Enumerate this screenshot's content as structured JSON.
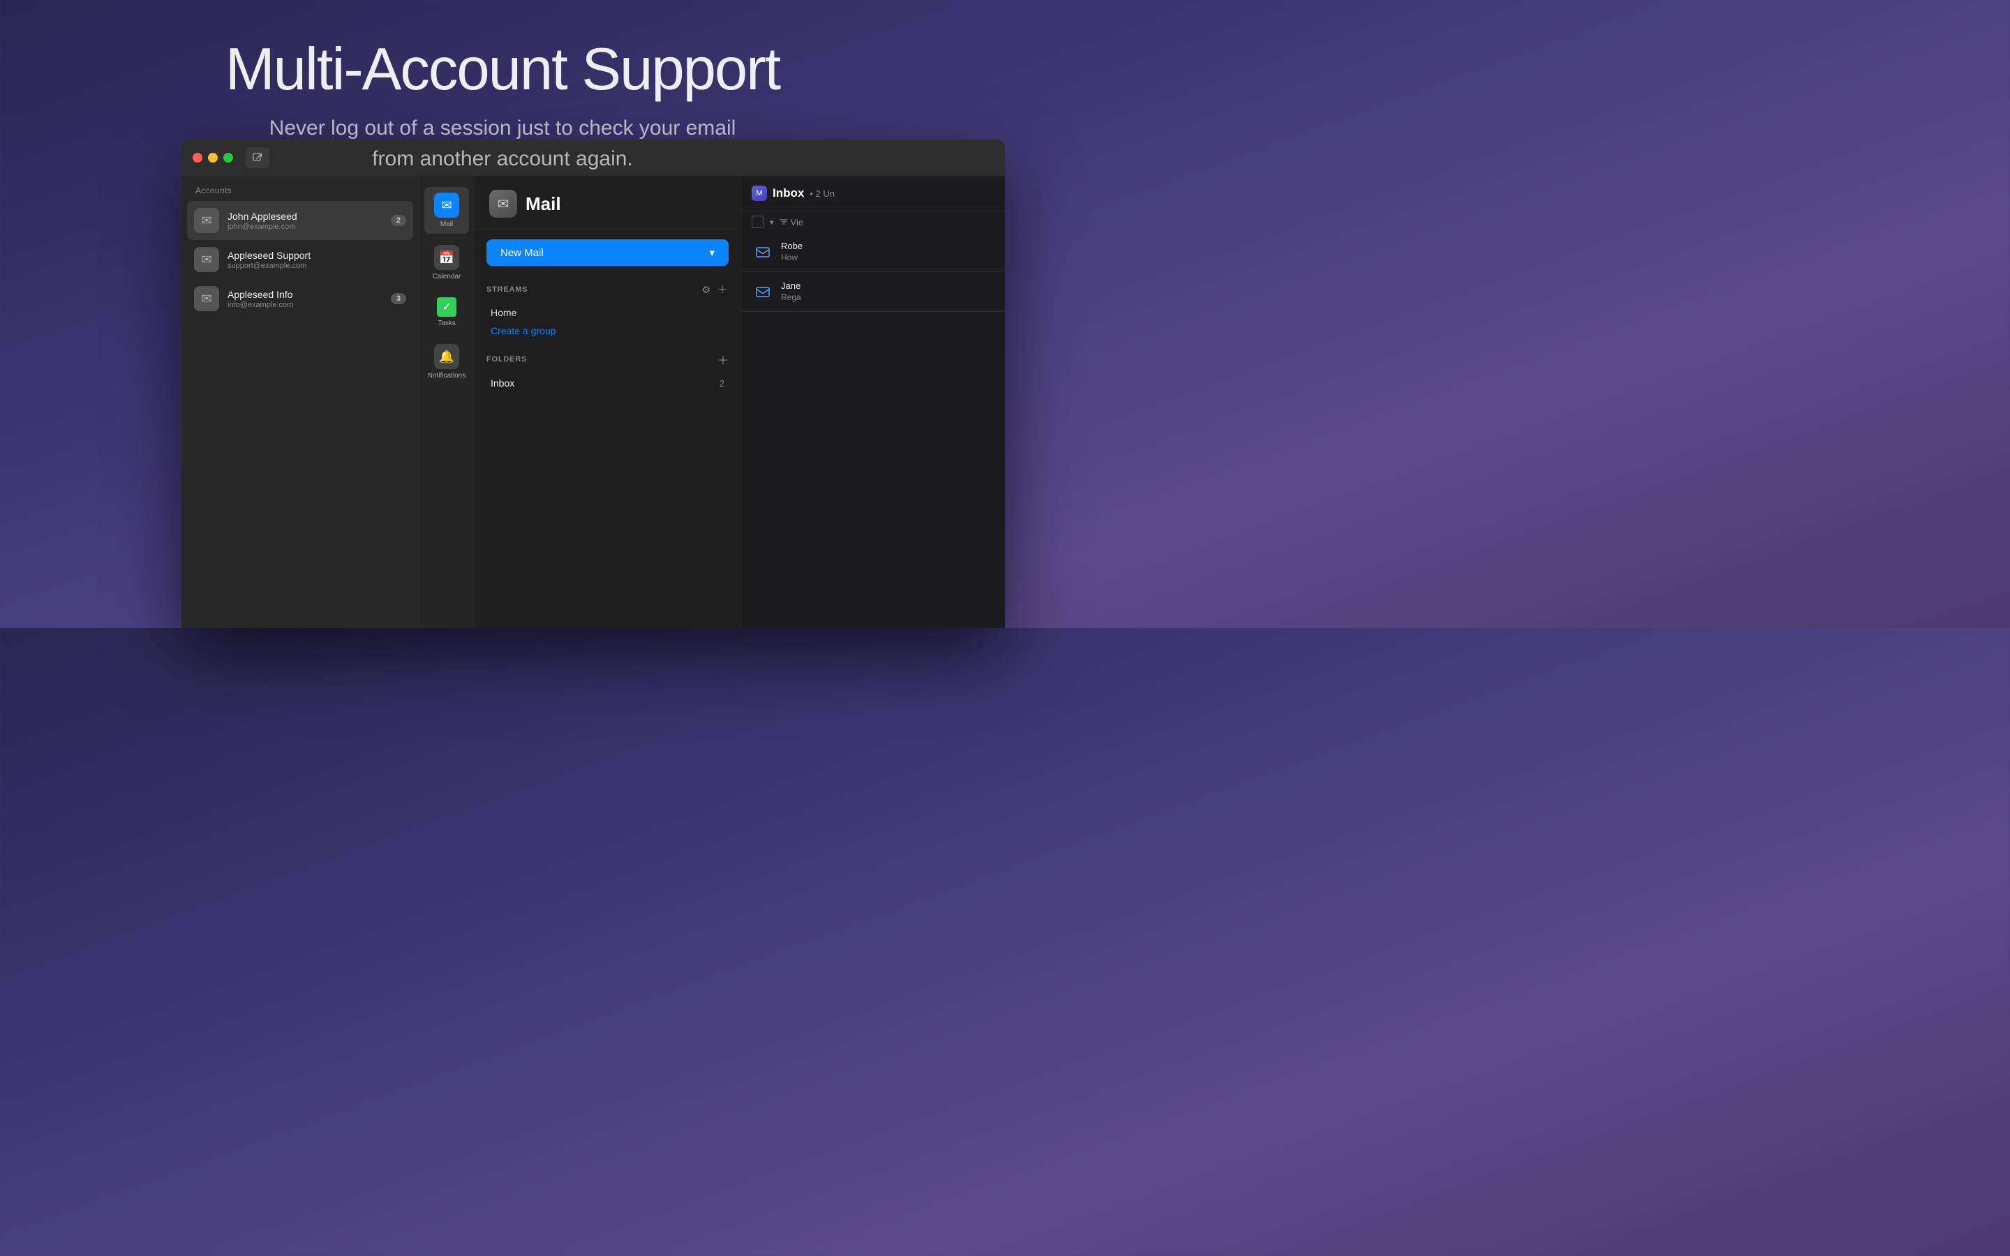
{
  "hero": {
    "title": "Multi-Account Support",
    "subtitle_line1": "Never log out of a session just to check your email",
    "subtitle_line2": "from another account again.",
    "subtitle": "Never log out of a session just to check your email from another account again."
  },
  "window": {
    "traffic_lights": [
      "close",
      "minimize",
      "maximize"
    ],
    "compose_icon": "✎"
  },
  "accounts_sidebar": {
    "section_label": "Accounts",
    "accounts": [
      {
        "name": "John Appleseed",
        "email": "john@example.com",
        "badge": "2",
        "selected": true
      },
      {
        "name": "Appleseed Support",
        "email": "support@example.com",
        "badge": null,
        "selected": false
      },
      {
        "name": "Appleseed Info",
        "email": "info@example.com",
        "badge": "3",
        "selected": false
      }
    ]
  },
  "nav_icons": [
    {
      "icon": "✉️",
      "label": "Mail",
      "active": true
    },
    {
      "icon": "📅",
      "label": "Calendar",
      "active": false
    },
    {
      "icon": "✅",
      "label": "Tasks",
      "active": false
    },
    {
      "icon": "🔔",
      "label": "Notifications",
      "active": false
    }
  ],
  "mail_panel": {
    "app_name": "Mail",
    "new_mail_label": "New Mail",
    "new_mail_chevron": "▾",
    "streams": {
      "section_label": "STREAMS",
      "items": [
        "Home"
      ],
      "create_group_label": "Create a group"
    },
    "folders": {
      "section_label": "FOLDERS",
      "items": [
        {
          "name": "Inbox",
          "count": "2"
        }
      ]
    }
  },
  "message_list": {
    "app_name": "Mail",
    "inbox_title": "Inbox",
    "unread_badge": "2 Un",
    "filter_label": "Vie",
    "messages": [
      {
        "sender": "Robe",
        "preview": "How"
      },
      {
        "sender": "Jane",
        "preview": "Rega"
      }
    ]
  },
  "colors": {
    "accent_blue": "#0a84ff",
    "traffic_close": "#ff5f57",
    "traffic_minimize": "#febc2e",
    "traffic_maximize": "#28c840",
    "active_green": "#30d158"
  }
}
